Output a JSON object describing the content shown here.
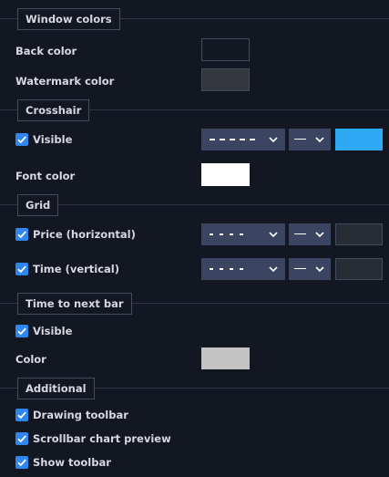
{
  "window_colors": {
    "title": "Window colors",
    "back_color_label": "Back color",
    "back_color": "#131722",
    "watermark_color_label": "Watermark color",
    "watermark_color": "#34363d"
  },
  "crosshair": {
    "title": "Crosshair",
    "visible_label": "Visible",
    "visible_checked": true,
    "line_style": "dashed",
    "line_width": "thin",
    "line_color": "#2ea9f3",
    "font_color_label": "Font color",
    "font_color": "#ffffff"
  },
  "grid": {
    "title": "Grid",
    "price_label": "Price (horizontal)",
    "price_checked": true,
    "price_line_style": "dotted",
    "price_line_width": "thin",
    "price_color": "#282c35",
    "time_label": "Time (vertical)",
    "time_checked": true,
    "time_line_style": "dotted",
    "time_line_width": "thin",
    "time_color": "#282c35"
  },
  "time_to_next_bar": {
    "title": "Time to next bar",
    "visible_label": "Visible",
    "visible_checked": true,
    "color_label": "Color",
    "color": "#c3c3c3"
  },
  "additional": {
    "title": "Additional",
    "drawing_toolbar_label": "Drawing toolbar",
    "drawing_toolbar_checked": true,
    "scrollbar_preview_label": "Scrollbar chart preview",
    "scrollbar_preview_checked": true,
    "show_toolbar_label": "Show toolbar",
    "show_toolbar_checked": true
  },
  "icons": {
    "checkbox": "check-icon",
    "dropdown": "chevron-down-icon"
  }
}
